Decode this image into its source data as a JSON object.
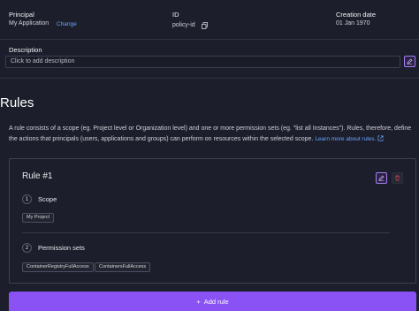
{
  "policy": {
    "principal_label": "Principal",
    "principal_value": "My Application",
    "change_link": "Change",
    "id_label": "ID",
    "id_value": "policy-id",
    "creation_label": "Creation date",
    "creation_value": "01 Jan 1970"
  },
  "description": {
    "label": "Description",
    "placeholder": "Click to add description"
  },
  "rules": {
    "title": "Rules",
    "intro": "A rule consists of a scope (eg. Project level or Organization level) and one or more permission sets (eg. \"list all Instances\"). Rules, therefore, define the actions that principals (users, applications and groups) can perform on resources within the selected scope.",
    "learn_more": "Learn more about rules."
  },
  "rule_card": {
    "title": "Rule #1",
    "step1_num": "1",
    "step1_label": "Scope",
    "scope_chip": "My Project",
    "step2_num": "2",
    "step2_label": "Permission sets",
    "permission_chips": [
      "ContainerRegistryFullAccess",
      "ContainersFullAccess"
    ]
  },
  "add_rule": {
    "plus": "+",
    "label": "Add rule"
  },
  "icons": {
    "copy": "copy-icon",
    "edit": "edit-icon",
    "delete": "trash-icon",
    "external": "external-link-icon"
  },
  "colors": {
    "background": "#1c1f2b",
    "accent": "#8a52f5",
    "link": "#6aa4ff",
    "danger": "#c0455a"
  }
}
